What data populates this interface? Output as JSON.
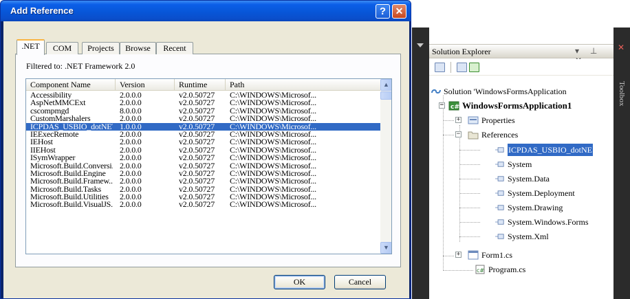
{
  "dialog": {
    "title": "Add Reference",
    "help_glyph": "?",
    "close_glyph": "✕",
    "tabs": [
      {
        "label": ".NET",
        "active": true
      },
      {
        "label": "COM",
        "active": false
      },
      {
        "label": "Projects",
        "active": false
      },
      {
        "label": "Browse",
        "active": false
      },
      {
        "label": "Recent",
        "active": false
      }
    ],
    "filter_text": "Filtered to: .NET Framework 2.0",
    "columns": [
      "Component Name",
      "Version",
      "Runtime",
      "Path"
    ],
    "rows": [
      {
        "name": "Accessibility",
        "version": "2.0.0.0",
        "runtime": "v2.0.50727",
        "path": "C:\\WINDOWS\\Microsof...",
        "selected": false
      },
      {
        "name": "AspNetMMCExt",
        "version": "2.0.0.0",
        "runtime": "v2.0.50727",
        "path": "C:\\WINDOWS\\Microsof...",
        "selected": false
      },
      {
        "name": "cscompmgd",
        "version": "8.0.0.0",
        "runtime": "v2.0.50727",
        "path": "C:\\WINDOWS\\Microsof...",
        "selected": false
      },
      {
        "name": "CustomMarshalers",
        "version": "2.0.0.0",
        "runtime": "v2.0.50727",
        "path": "C:\\WINDOWS\\Microsof...",
        "selected": false
      },
      {
        "name": "ICPDAS_USBIO_dotNET",
        "version": "1.0.0.0",
        "runtime": "v2.0.50727",
        "path": "C:\\WINDOWS\\Microsof...",
        "selected": true
      },
      {
        "name": "IEExecRemote",
        "version": "2.0.0.0",
        "runtime": "v2.0.50727",
        "path": "C:\\WINDOWS\\Microsof...",
        "selected": false
      },
      {
        "name": "IEHost",
        "version": "2.0.0.0",
        "runtime": "v2.0.50727",
        "path": "C:\\WINDOWS\\Microsof...",
        "selected": false
      },
      {
        "name": "IIEHost",
        "version": "2.0.0.0",
        "runtime": "v2.0.50727",
        "path": "C:\\WINDOWS\\Microsof...",
        "selected": false
      },
      {
        "name": "ISymWrapper",
        "version": "2.0.0.0",
        "runtime": "v2.0.50727",
        "path": "C:\\WINDOWS\\Microsof...",
        "selected": false
      },
      {
        "name": "Microsoft.Build.Conversi...",
        "version": "2.0.0.0",
        "runtime": "v2.0.50727",
        "path": "C:\\WINDOWS\\Microsof...",
        "selected": false
      },
      {
        "name": "Microsoft.Build.Engine",
        "version": "2.0.0.0",
        "runtime": "v2.0.50727",
        "path": "C:\\WINDOWS\\Microsof...",
        "selected": false
      },
      {
        "name": "Microsoft.Build.Framew...",
        "version": "2.0.0.0",
        "runtime": "v2.0.50727",
        "path": "C:\\WINDOWS\\Microsof...",
        "selected": false
      },
      {
        "name": "Microsoft.Build.Tasks",
        "version": "2.0.0.0",
        "runtime": "v2.0.50727",
        "path": "C:\\WINDOWS\\Microsof...",
        "selected": false
      },
      {
        "name": "Microsoft.Build.Utilities",
        "version": "2.0.0.0",
        "runtime": "v2.0.50727",
        "path": "C:\\WINDOWS\\Microsof...",
        "selected": false
      },
      {
        "name": "Microsoft.Build.VisualJS...",
        "version": "2.0.0.0",
        "runtime": "v2.0.50727",
        "path": "C:\\WINDOWS\\Microsof...",
        "selected": false
      }
    ],
    "ok_label": "OK",
    "cancel_label": "Cancel"
  },
  "solution_explorer": {
    "title": "Solution Explorer",
    "title_icons": "▾ ⊥ ✕",
    "toolbox_label": "Toolbox",
    "toolbox_close": "✕",
    "nodes": [
      {
        "label": "Solution 'WindowsFormsApplication",
        "icon": "solution-icon"
      },
      {
        "label": "WindowsFormsApplication1",
        "icon": "csharp-project-icon"
      },
      {
        "label": "Properties",
        "icon": "properties-icon"
      },
      {
        "label": "References",
        "icon": "folder-icon"
      },
      {
        "label": "ICPDAS_USBIO_dotNE",
        "icon": "reference-icon"
      },
      {
        "label": "System",
        "icon": "reference-icon"
      },
      {
        "label": "System.Data",
        "icon": "reference-icon"
      },
      {
        "label": "System.Deployment",
        "icon": "reference-icon"
      },
      {
        "label": "System.Drawing",
        "icon": "reference-icon"
      },
      {
        "label": "System.Windows.Forms",
        "icon": "reference-icon"
      },
      {
        "label": "System.Xml",
        "icon": "reference-icon"
      },
      {
        "label": "Form1.cs",
        "icon": "form-icon"
      },
      {
        "label": "Program.cs",
        "icon": "csharp-file-icon"
      }
    ]
  },
  "colors": {
    "title_blue": "#0756d8",
    "selection_blue": "#316ac5",
    "dialog_face": "#ece9d8"
  }
}
